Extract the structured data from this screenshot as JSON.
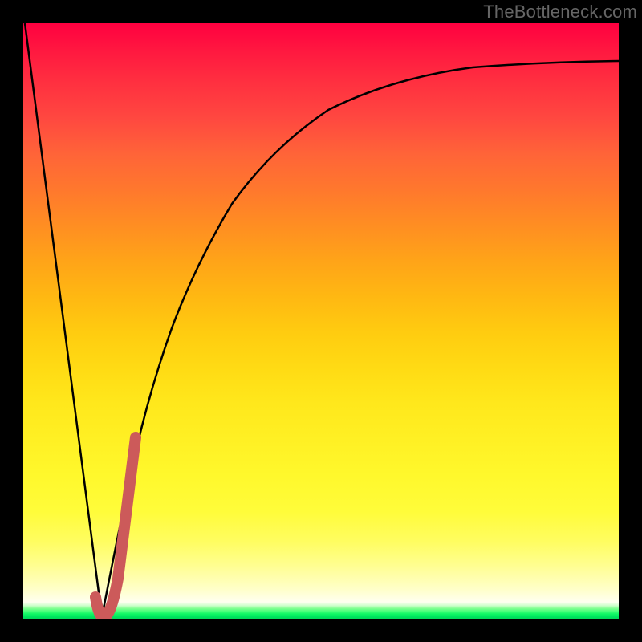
{
  "watermark": "TheBottleneck.com",
  "colors": {
    "background": "#000000",
    "curve": "#000000",
    "highlight": "#cc5a5a",
    "gradient_top": "#ff0040",
    "gradient_bottom": "#00d858"
  },
  "chart_data": {
    "type": "line",
    "title": "",
    "xlabel": "",
    "ylabel": "",
    "xlim": [
      0,
      100
    ],
    "ylim": [
      0,
      100
    ],
    "grid": false,
    "legend": null,
    "series": [
      {
        "name": "left-slope",
        "x": [
          0,
          13
        ],
        "values": [
          100,
          0
        ]
      },
      {
        "name": "right-curve",
        "x": [
          13,
          16,
          19,
          22,
          25,
          29,
          33,
          38,
          44,
          50,
          57,
          66,
          76,
          88,
          100
        ],
        "values": [
          0,
          16,
          29,
          40,
          49,
          57,
          64,
          70,
          75,
          79,
          82,
          85,
          87.5,
          89.3,
          90.5
        ]
      },
      {
        "name": "highlight-segment",
        "x": [
          12.3,
          13,
          15.8,
          18.5
        ],
        "values": [
          3,
          0,
          16,
          30
        ]
      }
    ]
  }
}
